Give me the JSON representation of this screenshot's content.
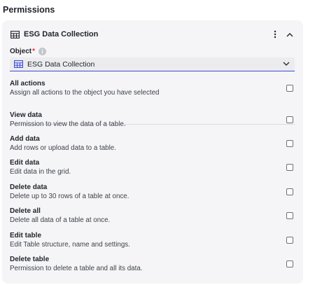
{
  "section": {
    "title": "Permissions"
  },
  "card": {
    "title": "ESG Data Collection",
    "icons": {
      "table": "table-icon",
      "menu": "kebab-icon",
      "collapse": "chevron-up-icon"
    }
  },
  "object_field": {
    "label": "Object",
    "required_mark": "*",
    "info_icon": "info-icon",
    "selected_value": "ESG Data Collection",
    "accent_color": "#3b4ad6"
  },
  "all_actions": {
    "title": "All actions",
    "description": "Assign all actions to the object you have selected",
    "checked": false
  },
  "permissions": [
    {
      "title": "View data",
      "description": "Permission to view the data of a table.",
      "checked": false
    },
    {
      "title": "Add data",
      "description": "Add rows or upload data to a table.",
      "checked": false
    },
    {
      "title": "Edit data",
      "description": "Edit data in the grid.",
      "checked": false
    },
    {
      "title": "Delete data",
      "description": "Delete up to 30 rows of a table at once.",
      "checked": false
    },
    {
      "title": "Delete all",
      "description": "Delete all data of a table at once.",
      "checked": false
    },
    {
      "title": "Edit table",
      "description": "Edit Table structure, name and settings.",
      "checked": false
    },
    {
      "title": "Delete table",
      "description": "Permission to delete a table and all its data.",
      "checked": false
    }
  ]
}
